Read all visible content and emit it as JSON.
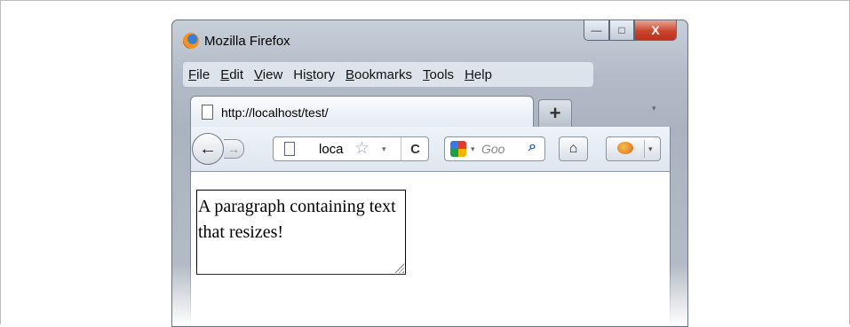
{
  "window": {
    "title": "Mozilla Firefox",
    "caption_buttons": {
      "minimize": "—",
      "maximize": "□",
      "close": "X"
    }
  },
  "menubar": {
    "items": [
      {
        "label": "File",
        "accel": "F"
      },
      {
        "label": "Edit",
        "accel": "E"
      },
      {
        "label": "View",
        "accel": "V"
      },
      {
        "label": "History",
        "accel": "s"
      },
      {
        "label": "Bookmarks",
        "accel": "B"
      },
      {
        "label": "Tools",
        "accel": "T"
      },
      {
        "label": "Help",
        "accel": "H"
      }
    ]
  },
  "tabs": {
    "active_title": "http://localhost/test/",
    "new_tab_label": "+",
    "list_arrow": "▾"
  },
  "navbar": {
    "back_glyph": "←",
    "forward_glyph": "→",
    "url_text": "loca",
    "star_glyph": "☆",
    "dropdown_glyph": "▾",
    "reload_glyph": "C",
    "search_engine_icon": "google-icon",
    "search_placeholder": "Goo",
    "search_go_glyph": "⌕",
    "home_glyph": "⌂",
    "addon_icon": "ladybug-icon"
  },
  "content": {
    "paragraph_text": "A paragraph containing text that resizes!"
  }
}
